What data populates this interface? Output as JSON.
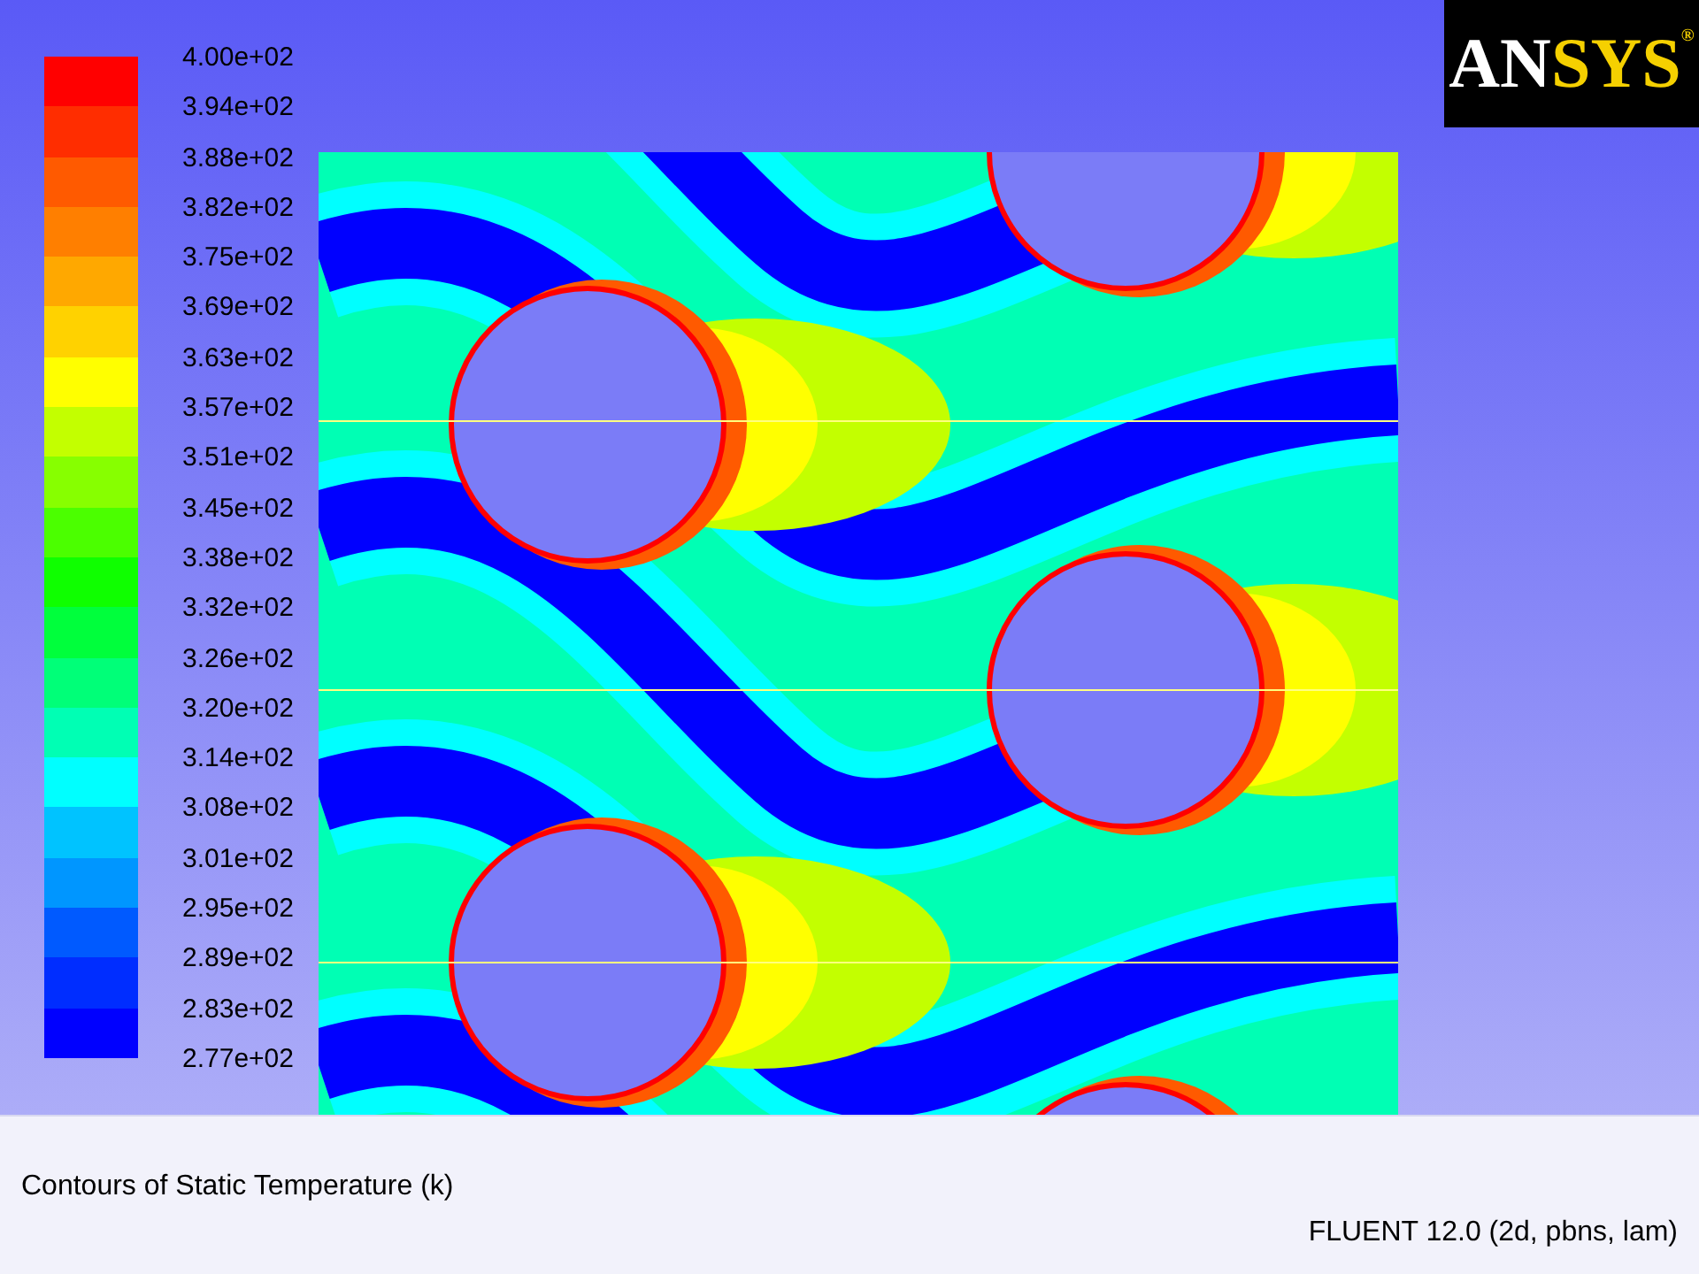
{
  "logo": {
    "part_1": "AN",
    "part_2": "SYS",
    "mark": "®"
  },
  "legend": [
    {
      "label": "4.00e+02",
      "color": "#ff0000"
    },
    {
      "label": "3.94e+02",
      "color": "#ff2d00"
    },
    {
      "label": "3.88e+02",
      "color": "#ff5a00"
    },
    {
      "label": "3.82e+02",
      "color": "#ff7f00"
    },
    {
      "label": "3.75e+02",
      "color": "#ffa800"
    },
    {
      "label": "3.69e+02",
      "color": "#ffd200"
    },
    {
      "label": "3.63e+02",
      "color": "#ffff00"
    },
    {
      "label": "3.57e+02",
      "color": "#c3ff00"
    },
    {
      "label": "3.51e+02",
      "color": "#87ff00"
    },
    {
      "label": "3.45e+02",
      "color": "#4bff00"
    },
    {
      "label": "3.38e+02",
      "color": "#0fff00"
    },
    {
      "label": "3.32e+02",
      "color": "#00ff3c"
    },
    {
      "label": "3.26e+02",
      "color": "#00ff78"
    },
    {
      "label": "3.20e+02",
      "color": "#00ffb4"
    },
    {
      "label": "3.14e+02",
      "color": "#00ffff"
    },
    {
      "label": "3.08e+02",
      "color": "#00c3ff"
    },
    {
      "label": "3.01e+02",
      "color": "#0096ff"
    },
    {
      "label": "2.95e+02",
      "color": "#005aff"
    },
    {
      "label": "2.89e+02",
      "color": "#002dff"
    },
    {
      "label": "2.83e+02",
      "color": "#0000ff"
    }
  ],
  "legend_min_label": "2.77e+02",
  "caption": "Contours of Static Temperature (k)",
  "solver": "FLUENT 12.0 (2d, pbns, lam)"
}
